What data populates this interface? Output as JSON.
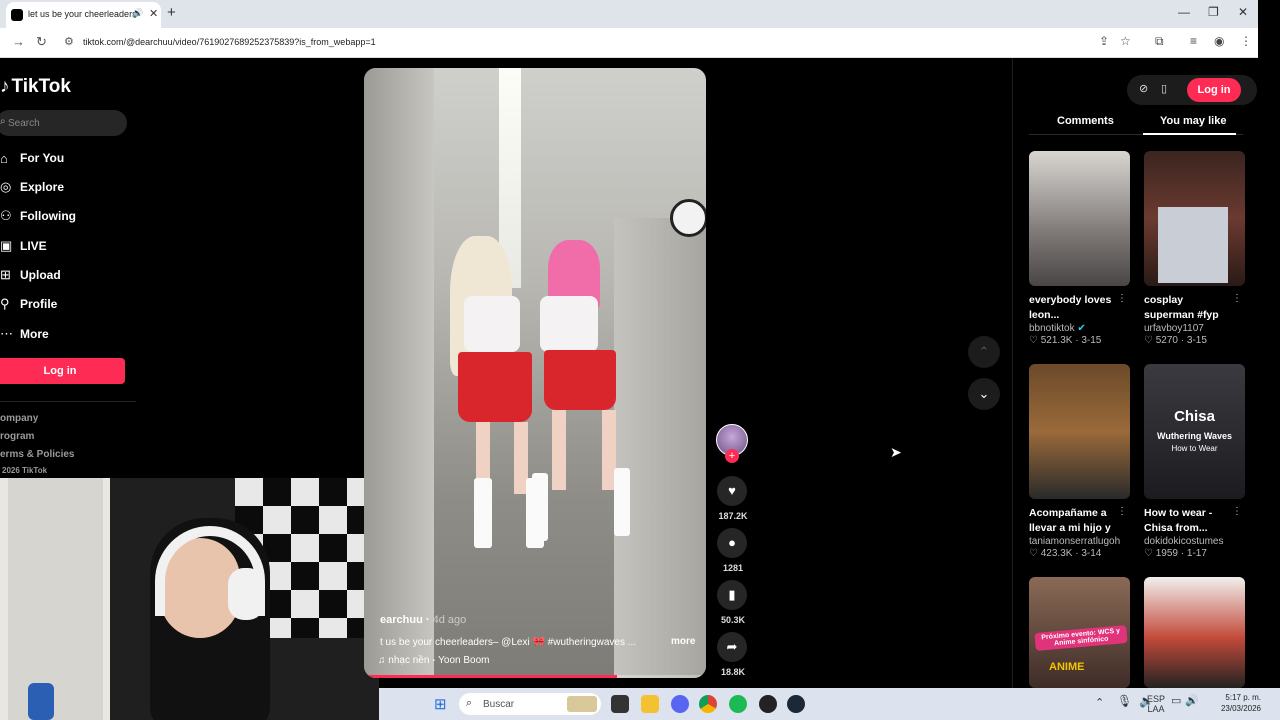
{
  "browser": {
    "tab_title": "let us be your cheerleaders",
    "url": "tiktok.com/@dearchuu/video/7619027689252375839?is_from_webapp=1"
  },
  "sidebar": {
    "logo": "TikTok",
    "search_placeholder": "Search",
    "items": [
      {
        "label": "For You",
        "icon": "home-icon"
      },
      {
        "label": "Explore",
        "icon": "compass-icon"
      },
      {
        "label": "Following",
        "icon": "following-icon"
      },
      {
        "label": "LIVE",
        "icon": "live-icon"
      },
      {
        "label": "Upload",
        "icon": "upload-icon"
      },
      {
        "label": "Profile",
        "icon": "profile-icon"
      },
      {
        "label": "More",
        "icon": "more-icon"
      }
    ],
    "login": "Log in",
    "footer": [
      "ompany",
      "rogram",
      "erms & Policies",
      "2026 TikTok"
    ]
  },
  "video": {
    "username": "earchuu",
    "time_ago": "4d ago",
    "description": "t us be your cheerleaders– @Lexi 🎀 #wutheringwaves ...",
    "more": "more",
    "music": "nhạc nền - Yoon Boom",
    "progress": 0.74
  },
  "actions": {
    "likes": "187.2K",
    "comments": "1281",
    "saves": "50.3K",
    "shares": "18.8K"
  },
  "right_panel": {
    "login": "Log in",
    "tabs": [
      "Comments",
      "You may like"
    ],
    "active_tab": "You may like",
    "cards": [
      {
        "title": "everybody loves leon...",
        "author": "bbnotiktok",
        "verified": true,
        "likes": "521.3K",
        "date": "3-15"
      },
      {
        "title": "cosplay superman #fyp #cosplay...",
        "author": "urfavboy1107",
        "likes": "5270",
        "date": "3-15"
      },
      {
        "title": "Acompañame a llevar a mi hijo y ...",
        "author": "taniamonserratlugoh",
        "likes": "423.3K",
        "date": "3-14"
      },
      {
        "title": "How to wear - Chisa from...",
        "author": "dokidokicostumes",
        "likes": "1959",
        "date": "1-17"
      },
      {
        "title": "",
        "author": "",
        "likes": "",
        "date": ""
      },
      {
        "title": "",
        "author": "",
        "likes": "",
        "date": ""
      }
    ],
    "thumb_texts": {
      "chisa": "Chisa",
      "wuthering": "Wuthering Waves",
      "howto": "How to Wear",
      "wcs": "Próximo evento: WCS y Anime sinfónico",
      "anime": "ANIME"
    }
  },
  "taskbar": {
    "search": "Buscar",
    "lang_top": "ESP",
    "lang_bottom": "LAA",
    "time": "5:17 p. m.",
    "date": "23/03/2026"
  }
}
